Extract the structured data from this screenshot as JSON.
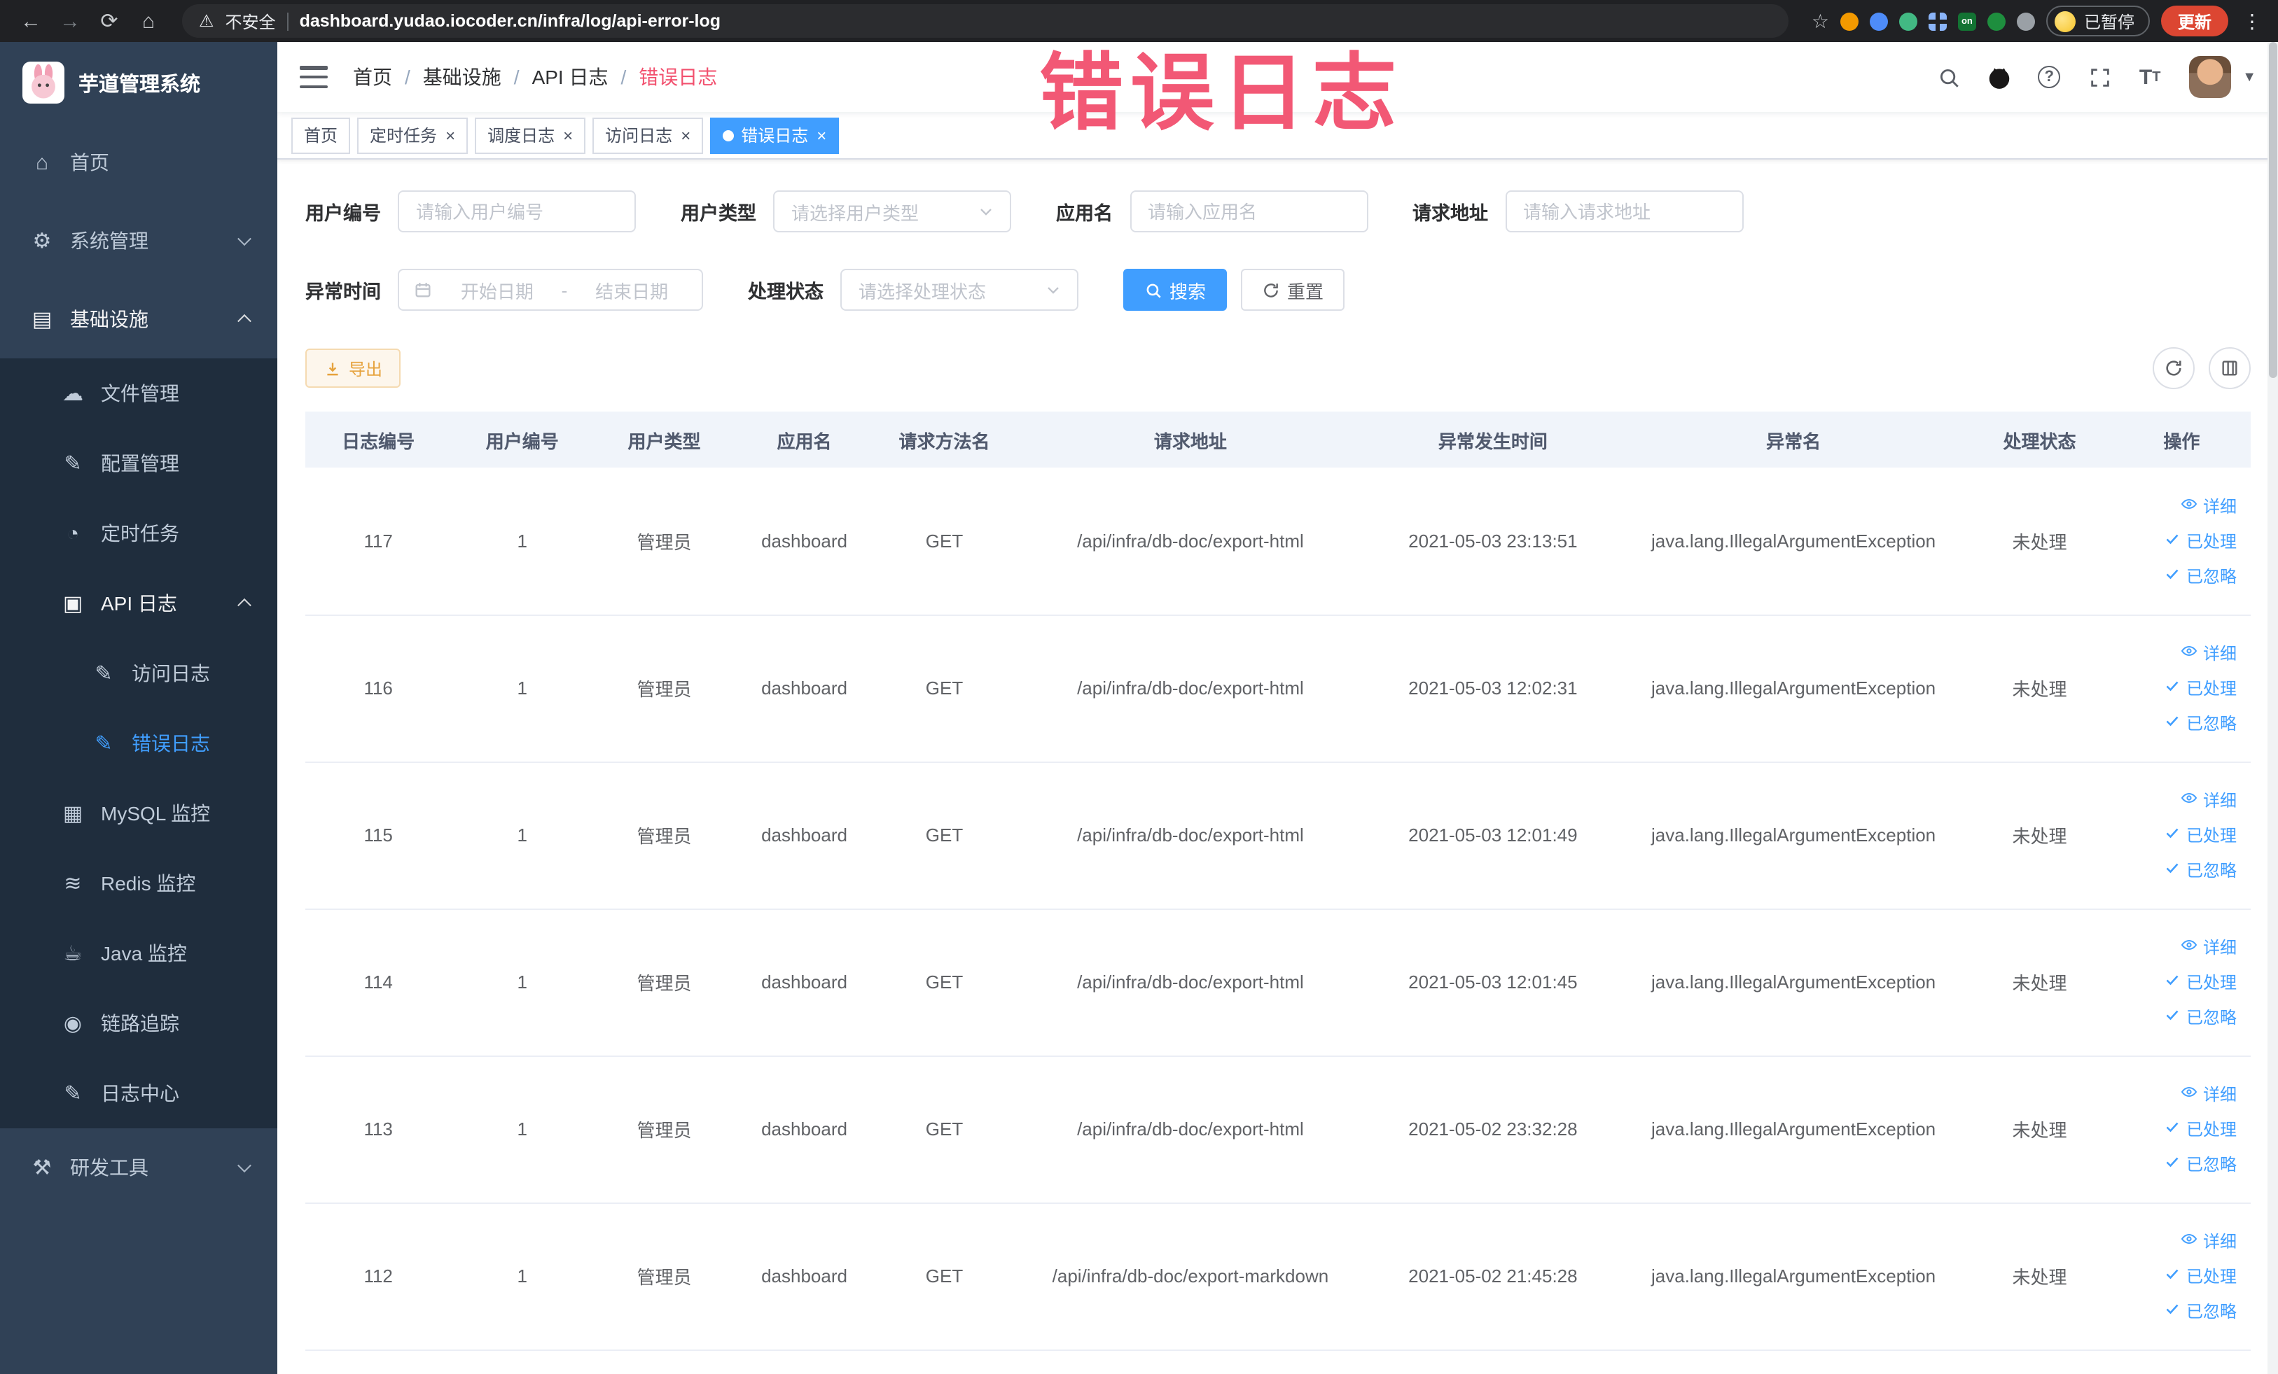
{
  "colors": {
    "accent": "#409EFF",
    "warning": "#E6A23C",
    "annotation_red": "#F2506E",
    "sidebar_bg": "#304156",
    "chrome_bg": "#202124"
  },
  "browser": {
    "security_label": "不安全",
    "url": "dashboard.yudao.iocoder.cn/infra/log/api-error-log",
    "extension_badge": "on",
    "paused_badge": "已暂停",
    "update_label": "更新"
  },
  "annotation": {
    "text": "错误日志"
  },
  "sidebar": {
    "logo_title": "芋道管理系统",
    "menu": [
      {
        "key": "home",
        "label": "首页",
        "icon": "home-icon",
        "level": 1
      },
      {
        "key": "system-management",
        "label": "系统管理",
        "icon": "gear-icon",
        "level": 1,
        "chevron": "down"
      },
      {
        "key": "infrastructure",
        "label": "基础设施",
        "icon": "infra-icon",
        "level": 1,
        "chevron": "up",
        "open": true
      },
      {
        "key": "file-management",
        "label": "文件管理",
        "icon": "cloud-icon",
        "level": 2
      },
      {
        "key": "config-management",
        "label": "配置管理",
        "icon": "edit-icon",
        "level": 2
      },
      {
        "key": "scheduled-tasks",
        "label": "定时任务",
        "icon": "timer-icon",
        "level": 2
      },
      {
        "key": "api-log",
        "label": "API 日志",
        "icon": "api-log-icon",
        "level": 2,
        "chevron": "up",
        "open": true
      },
      {
        "key": "access-log",
        "label": "访问日志",
        "icon": "edit-icon",
        "level": 3
      },
      {
        "key": "error-log",
        "label": "错误日志",
        "icon": "edit-icon",
        "level": 3,
        "active": true
      },
      {
        "key": "mysql-monitor",
        "label": "MySQL 监控",
        "icon": "mysql-icon",
        "level": 2
      },
      {
        "key": "redis-monitor",
        "label": "Redis 监控",
        "icon": "redis-icon",
        "level": 2
      },
      {
        "key": "java-monitor",
        "label": "Java 监控",
        "icon": "java-icon",
        "level": 2
      },
      {
        "key": "trace",
        "label": "链路追踪",
        "icon": "trace-icon",
        "level": 2
      },
      {
        "key": "log-center",
        "label": "日志中心",
        "icon": "log-center-icon",
        "level": 2
      },
      {
        "key": "dev-tools",
        "label": "研发工具",
        "icon": "tools-icon",
        "level": 1,
        "chevron": "down"
      }
    ]
  },
  "header": {
    "breadcrumb": [
      "首页",
      "基础设施",
      "API 日志",
      "错误日志"
    ]
  },
  "tabs": [
    {
      "key": "home",
      "label": "首页",
      "closable": false,
      "active": false
    },
    {
      "key": "scheduled-tasks",
      "label": "定时任务",
      "closable": true,
      "active": false
    },
    {
      "key": "schedule-log",
      "label": "调度日志",
      "closable": true,
      "active": false
    },
    {
      "key": "access-log",
      "label": "访问日志",
      "closable": true,
      "active": false
    },
    {
      "key": "error-log",
      "label": "错误日志",
      "closable": true,
      "active": true
    }
  ],
  "filters": {
    "user_id": {
      "label": "用户编号",
      "placeholder": "请输入用户编号"
    },
    "user_type": {
      "label": "用户类型",
      "placeholder": "请选择用户类型"
    },
    "app_name": {
      "label": "应用名",
      "placeholder": "请输入应用名"
    },
    "request_url": {
      "label": "请求地址",
      "placeholder": "请输入请求地址"
    },
    "exception_time": {
      "label": "异常时间",
      "start_placeholder": "开始日期",
      "separator": "-",
      "end_placeholder": "结束日期"
    },
    "process_status": {
      "label": "处理状态",
      "placeholder": "请选择处理状态"
    },
    "search_label": "搜索",
    "reset_label": "重置"
  },
  "toolbar": {
    "export_label": "导出"
  },
  "table": {
    "columns": [
      "日志编号",
      "用户编号",
      "用户类型",
      "应用名",
      "请求方法名",
      "请求地址",
      "异常发生时间",
      "异常名",
      "处理状态",
      "操作"
    ],
    "action_labels": [
      "详细",
      "已处理",
      "已忽略"
    ],
    "rows": [
      {
        "id": "117",
        "user_id": "1",
        "user_type": "管理员",
        "app": "dashboard",
        "method": "GET",
        "url": "/api/infra/db-doc/export-html",
        "time": "2021-05-03 23:13:51",
        "exception": "java.lang.IllegalArgumentException",
        "status": "未处理"
      },
      {
        "id": "116",
        "user_id": "1",
        "user_type": "管理员",
        "app": "dashboard",
        "method": "GET",
        "url": "/api/infra/db-doc/export-html",
        "time": "2021-05-03 12:02:31",
        "exception": "java.lang.IllegalArgumentException",
        "status": "未处理"
      },
      {
        "id": "115",
        "user_id": "1",
        "user_type": "管理员",
        "app": "dashboard",
        "method": "GET",
        "url": "/api/infra/db-doc/export-html",
        "time": "2021-05-03 12:01:49",
        "exception": "java.lang.IllegalArgumentException",
        "status": "未处理"
      },
      {
        "id": "114",
        "user_id": "1",
        "user_type": "管理员",
        "app": "dashboard",
        "method": "GET",
        "url": "/api/infra/db-doc/export-html",
        "time": "2021-05-03 12:01:45",
        "exception": "java.lang.IllegalArgumentException",
        "status": "未处理"
      },
      {
        "id": "113",
        "user_id": "1",
        "user_type": "管理员",
        "app": "dashboard",
        "method": "GET",
        "url": "/api/infra/db-doc/export-html",
        "time": "2021-05-02 23:32:28",
        "exception": "java.lang.IllegalArgumentException",
        "status": "未处理"
      },
      {
        "id": "112",
        "user_id": "1",
        "user_type": "管理员",
        "app": "dashboard",
        "method": "GET",
        "url": "/api/infra/db-doc/export-markdown",
        "time": "2021-05-02 21:45:28",
        "exception": "java.lang.IllegalArgumentException",
        "status": "未处理"
      }
    ]
  }
}
